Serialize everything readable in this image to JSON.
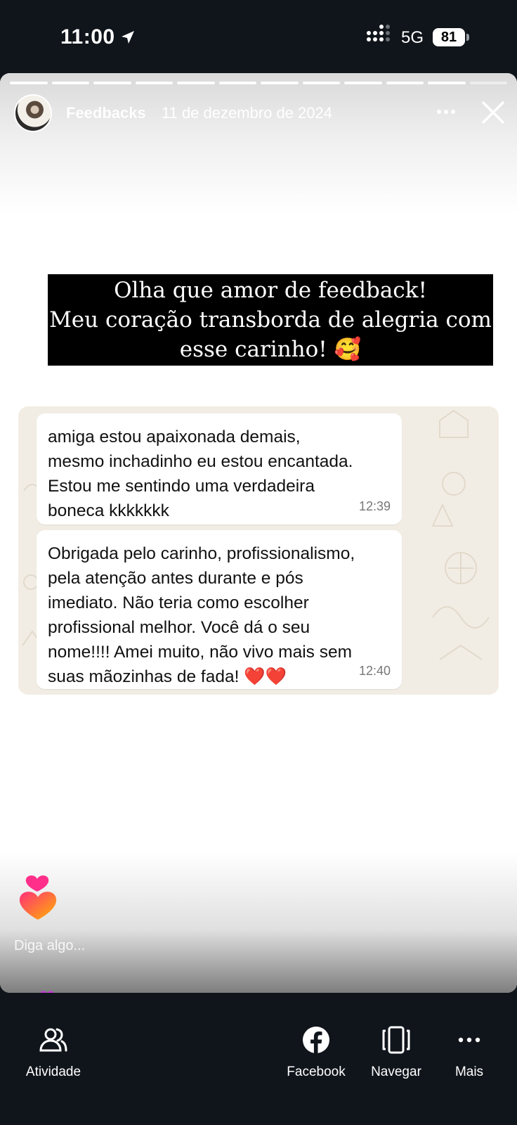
{
  "status_bar": {
    "time": "11:00",
    "network": "5G",
    "battery": "81"
  },
  "story": {
    "account_name": "Feedbacks",
    "date": "11 de dezembro de 2024",
    "headline_lines": [
      "Olha que amor de feedback!",
      "Meu coração transborda de alegria com",
      "esse carinho! 🥰"
    ],
    "messages": [
      {
        "text": "amiga estou apaixonada demais,\nmesmo inchadinho eu estou encantada.\nEstou me sentindo uma verdadeira\nboneca kkkkkkk",
        "time": "12:39"
      },
      {
        "text": "Obrigada pelo carinho, profissionalismo,\npela atenção antes durante e pós\nimediato. Não teria como escolher\nprofissional melhor. Você dá o seu\nnome!!!!  Amei muito, não vivo mais sem\nsuas mãozinhas de fada! ❤️❤️",
        "time": "12:40"
      }
    ],
    "reply_placeholder": "Diga algo..."
  },
  "bottom_nav": [
    {
      "label": "Atividade",
      "icon": "activity-icon"
    },
    {
      "label": "Facebook",
      "icon": "facebook-icon"
    },
    {
      "label": "Navegar",
      "icon": "navigate-icon"
    },
    {
      "label": "Mais",
      "icon": "more-horizontal-icon"
    }
  ],
  "colors": {
    "bar_background": "#10151b",
    "chat_background": "#f2ede4",
    "headline_background": "#000000"
  }
}
